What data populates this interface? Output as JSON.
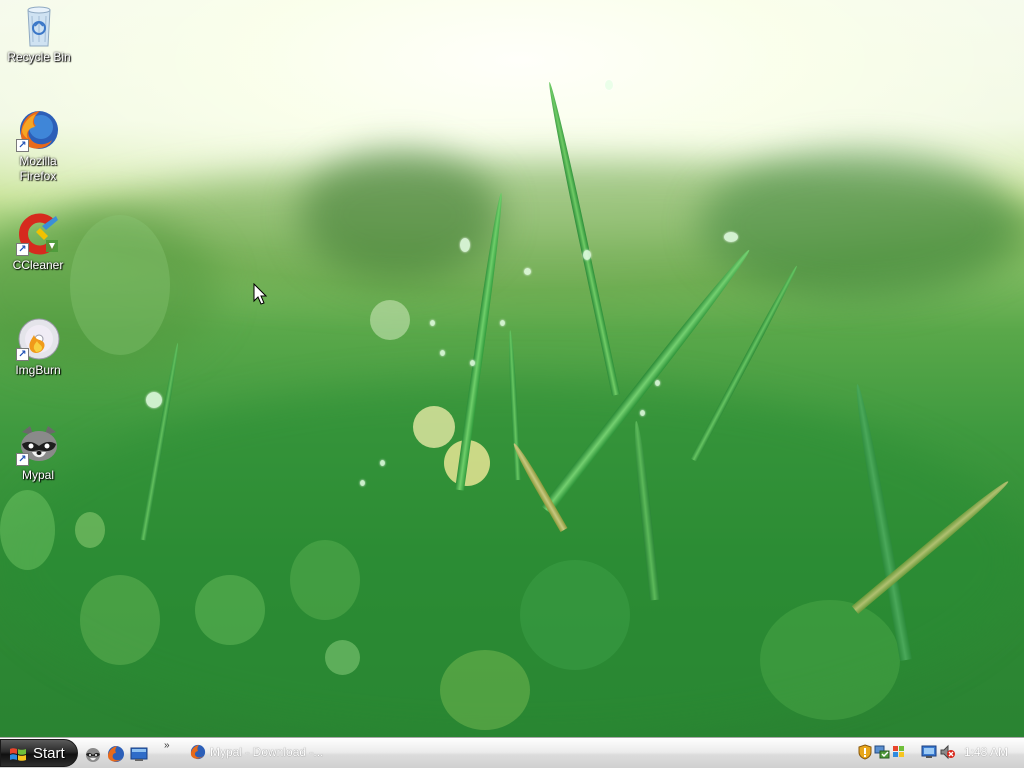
{
  "desktop": {
    "icons": [
      {
        "label": "Recycle Bin",
        "icon": "recycle-bin-icon",
        "shortcut": false
      },
      {
        "label": "Mozilla Firefox",
        "icon": "firefox-icon",
        "shortcut": true
      },
      {
        "label": "CCleaner",
        "icon": "ccleaner-icon",
        "shortcut": true
      },
      {
        "label": "ImgBurn",
        "icon": "imgburn-icon",
        "shortcut": true
      },
      {
        "label": "Mypal",
        "icon": "mypal-icon",
        "shortcut": true
      }
    ]
  },
  "taskbar": {
    "start_label": "Start",
    "quick_launch": [
      "mypal-icon",
      "firefox-icon",
      "show-desktop-icon"
    ],
    "overflow_chevron": "»",
    "tasks": [
      {
        "label": "Mypal - Download -...",
        "icon": "mypal-icon"
      }
    ],
    "tray_icons": [
      "security-shield-icon",
      "network-icon",
      "windows-update-icon",
      "display-icon",
      "volume-muted-icon"
    ],
    "clock": "1:48 AM"
  },
  "colors": {
    "taskbar_top": "#fdfdfd",
    "taskbar_bottom": "#d0d0d0",
    "start_button": "#1a1a1a",
    "wallpaper_green": "#3f9a3f"
  }
}
